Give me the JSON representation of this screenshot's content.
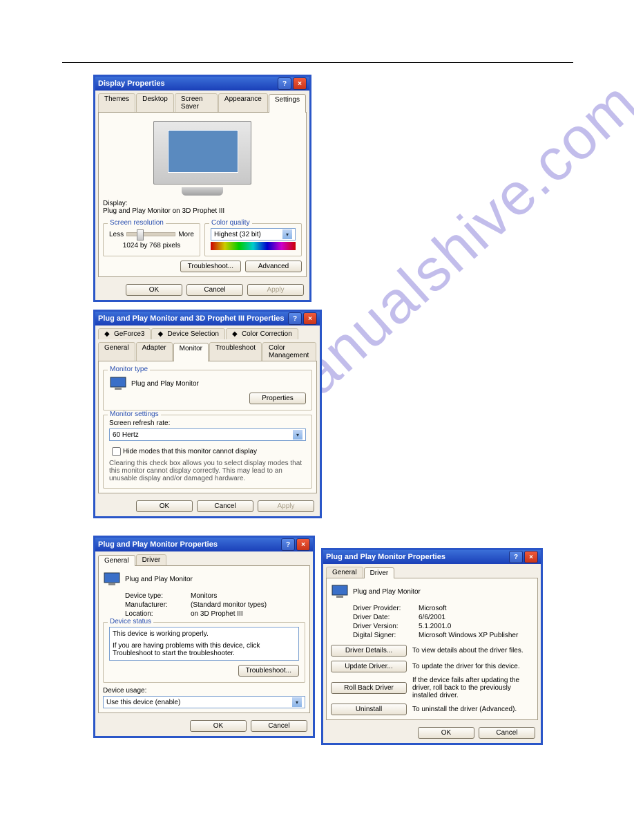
{
  "dlg1": {
    "title": "Display Properties",
    "tabs": [
      "Themes",
      "Desktop",
      "Screen Saver",
      "Appearance",
      "Settings"
    ],
    "activeTab": 4,
    "displayLabel": "Display:",
    "displayValue": "Plug and Play Monitor on 3D Prophet III",
    "resGroup": "Screen resolution",
    "less": "Less",
    "more": "More",
    "resText": "1024 by 768 pixels",
    "colorGroup": "Color quality",
    "colorValue": "Highest (32 bit)",
    "troubleshoot": "Troubleshoot...",
    "advanced": "Advanced",
    "ok": "OK",
    "cancel": "Cancel",
    "apply": "Apply"
  },
  "dlg2": {
    "title": "Plug and Play Monitor and 3D Prophet III Properties",
    "tabsTop": [
      "GeForce3",
      "Device Selection",
      "Color Correction"
    ],
    "tabsMain": [
      "General",
      "Adapter",
      "Monitor",
      "Troubleshoot",
      "Color Management"
    ],
    "activeMain": 2,
    "monitorTypeGroup": "Monitor type",
    "monitorName": "Plug and Play Monitor",
    "properties": "Properties",
    "monitorSettingsGroup": "Monitor settings",
    "refreshLabel": "Screen refresh rate:",
    "refreshValue": "60 Hertz",
    "hideModes": "Hide modes that this monitor cannot display",
    "hideDesc": "Clearing this check box allows you to select display modes that this monitor cannot display correctly. This may lead to an unusable display and/or damaged hardware.",
    "ok": "OK",
    "cancel": "Cancel",
    "apply": "Apply"
  },
  "dlg3": {
    "title": "Plug and Play Monitor Properties",
    "tabs": [
      "General",
      "Driver"
    ],
    "activeTab": 0,
    "deviceName": "Plug and Play Monitor",
    "devTypeLbl": "Device type:",
    "devTypeVal": "Monitors",
    "mfgLbl": "Manufacturer:",
    "mfgVal": "(Standard monitor types)",
    "locLbl": "Location:",
    "locVal": "on 3D Prophet III",
    "statusGroup": "Device status",
    "statusText": "This device is working properly.",
    "statusHelp": "If you are having problems with this device, click Troubleshoot to start the troubleshooter.",
    "troubleshoot": "Troubleshoot...",
    "usageLbl": "Device usage:",
    "usageVal": "Use this device (enable)",
    "ok": "OK",
    "cancel": "Cancel"
  },
  "dlg4": {
    "title": "Plug and Play Monitor Properties",
    "tabs": [
      "General",
      "Driver"
    ],
    "activeTab": 1,
    "deviceName": "Plug and Play Monitor",
    "provLbl": "Driver Provider:",
    "provVal": "Microsoft",
    "dateLbl": "Driver Date:",
    "dateVal": "6/6/2001",
    "verLbl": "Driver Version:",
    "verVal": "5.1.2001.0",
    "signerLbl": "Digital Signer:",
    "signerVal": "Microsoft Windows XP Publisher",
    "details": "Driver Details...",
    "detailsDesc": "To view details about the driver files.",
    "update": "Update Driver...",
    "updateDesc": "To update the driver for this device.",
    "rollback": "Roll Back Driver",
    "rollbackDesc": "If the device fails after updating the driver, roll back to the previously installed driver.",
    "uninstall": "Uninstall",
    "uninstallDesc": "To uninstall the driver (Advanced).",
    "ok": "OK",
    "cancel": "Cancel"
  }
}
